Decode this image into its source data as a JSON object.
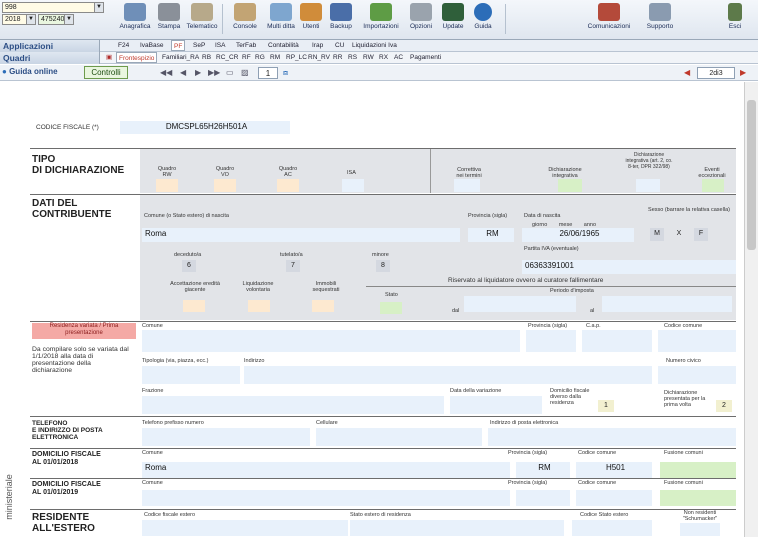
{
  "combos": {
    "top": "998",
    "year": "2018",
    "client": "475240"
  },
  "toolbar": {
    "buttons": [
      "Anagrafica",
      "Stampa",
      "Telematico",
      "Console",
      "Multi ditta",
      "Utenti",
      "Backup",
      "Importazioni",
      "Opzioni",
      "Update",
      "Guida"
    ],
    "right": [
      "Comunicazioni",
      "Supporto",
      "Esci"
    ]
  },
  "row2": {
    "label": "Applicazioni",
    "tabs": [
      "F24",
      "IvaBase",
      "PF",
      "SeP",
      "ISA",
      "TerFab",
      "Contabilità",
      "Irap",
      "CU",
      "Liquidazioni Iva"
    ],
    "selected": "PF"
  },
  "row3": {
    "label": "Quadri",
    "tabs": [
      "Frontespizio",
      "Familiari_RA",
      "RB",
      "RC_CR",
      "RF",
      "RG",
      "RM",
      "RP_LC",
      "RN_RV",
      "RR",
      "RS",
      "RW",
      "RX",
      "AC",
      "Pagamenti"
    ],
    "selected": "Frontespizio"
  },
  "nav": {
    "guida": "Guida online",
    "controlli": "Controlli",
    "page": "1",
    "page_count": "2di3"
  },
  "form": {
    "cf_label": "CODICE FISCALE (*)",
    "cf_value": "DMCSPL65H26H501A",
    "tipo_title": "TIPO\nDI DICHIARAZIONE",
    "tipo_cols": [
      "Quadro RW",
      "Quadro VO",
      "Quadro AC",
      "ISA",
      "Correttiva nei termini",
      "Dichiarazione integrativa",
      "Dichiarazione integrativa (art. 2, co. 8-ter, DPR 322/98)",
      "Eventi eccezionali"
    ],
    "dati_title": "DATI DEL\nCONTRIBUENTE",
    "comune_label": "Comune (o Stato estero) di nascita",
    "comune_value": "Roma",
    "prov_label": "Provincia (sigla)",
    "prov_value": "RM",
    "data_label": "Data di nascita",
    "data_sub": "giorno mese anno",
    "data_value": "26/06/1965",
    "sesso_label": "Sesso (barrare la relativa casella)",
    "sesso_m": "M",
    "sesso_x": "X",
    "sesso_f": "F",
    "deceduto": "deceduto/a",
    "tutelato": "tutelato/a",
    "minore": "minore",
    "deceduto_v": "6",
    "tutelato_v": "7",
    "minore_v": "8",
    "piva_label": "Partita IVA (eventuale)",
    "piva_value": "06363391001",
    "accettazione": "Accettazione eredità giacente",
    "liquidazione": "Liquidazione volontaria",
    "immobili": "Immobili sequestrati",
    "riservato": "Riservato al liquidatore ovvero al curatore fallimentare",
    "stato": "Stato",
    "periodo": "Periodo d'imposta",
    "dal": "dal",
    "al": "al",
    "residenza_btn": "Residenza variata / Prima presentazione",
    "residenza_note": "Da compilare solo se variata dal 1/1/2018 alla data di presentazione della dichiarazione",
    "comune": "Comune",
    "provincia": "Provincia (sigla)",
    "cap": "C.a.p.",
    "codice_comune": "Codice comune",
    "tipologia": "Tipologia (via, piazza, ecc.)",
    "indirizzo": "Indirizzo",
    "numero_civico": "Numero civico",
    "frazione": "Frazione",
    "data_variazione": "Data della variazione",
    "domicilio_var": "Domicilio fiscale diverso dalla residenza",
    "domicilio_var_v": "1",
    "dich_prima": "Dichiarazione presentata per la prima volta",
    "dich_prima_v": "2",
    "tel_title": "TELEFONO\nE INDIRIZZO DI POSTA\nELETTRONICA",
    "telefono": "Telefono prefisso numero",
    "cellulare": "Cellulare",
    "email": "Indirizzo di posta elettronica",
    "dom18_title": "DOMICILIO FISCALE\nAL 01/01/2018",
    "dom18_comune": "Roma",
    "dom18_prov": "RM",
    "dom18_cod": "H501",
    "fusione": "Fusione comuni",
    "dom19_title": "DOMICILIO FISCALE\nAL 01/01/2019",
    "res_title": "RESIDENTE\nALL'ESTERO",
    "cf_estero": "Codice fiscale estero",
    "stato_estero": "Stato estero di residenza",
    "codice_stato": "Codice Stato estero",
    "non_residenti": "Non residenti \"Schumacker\""
  },
  "side_label": "ministeriale"
}
